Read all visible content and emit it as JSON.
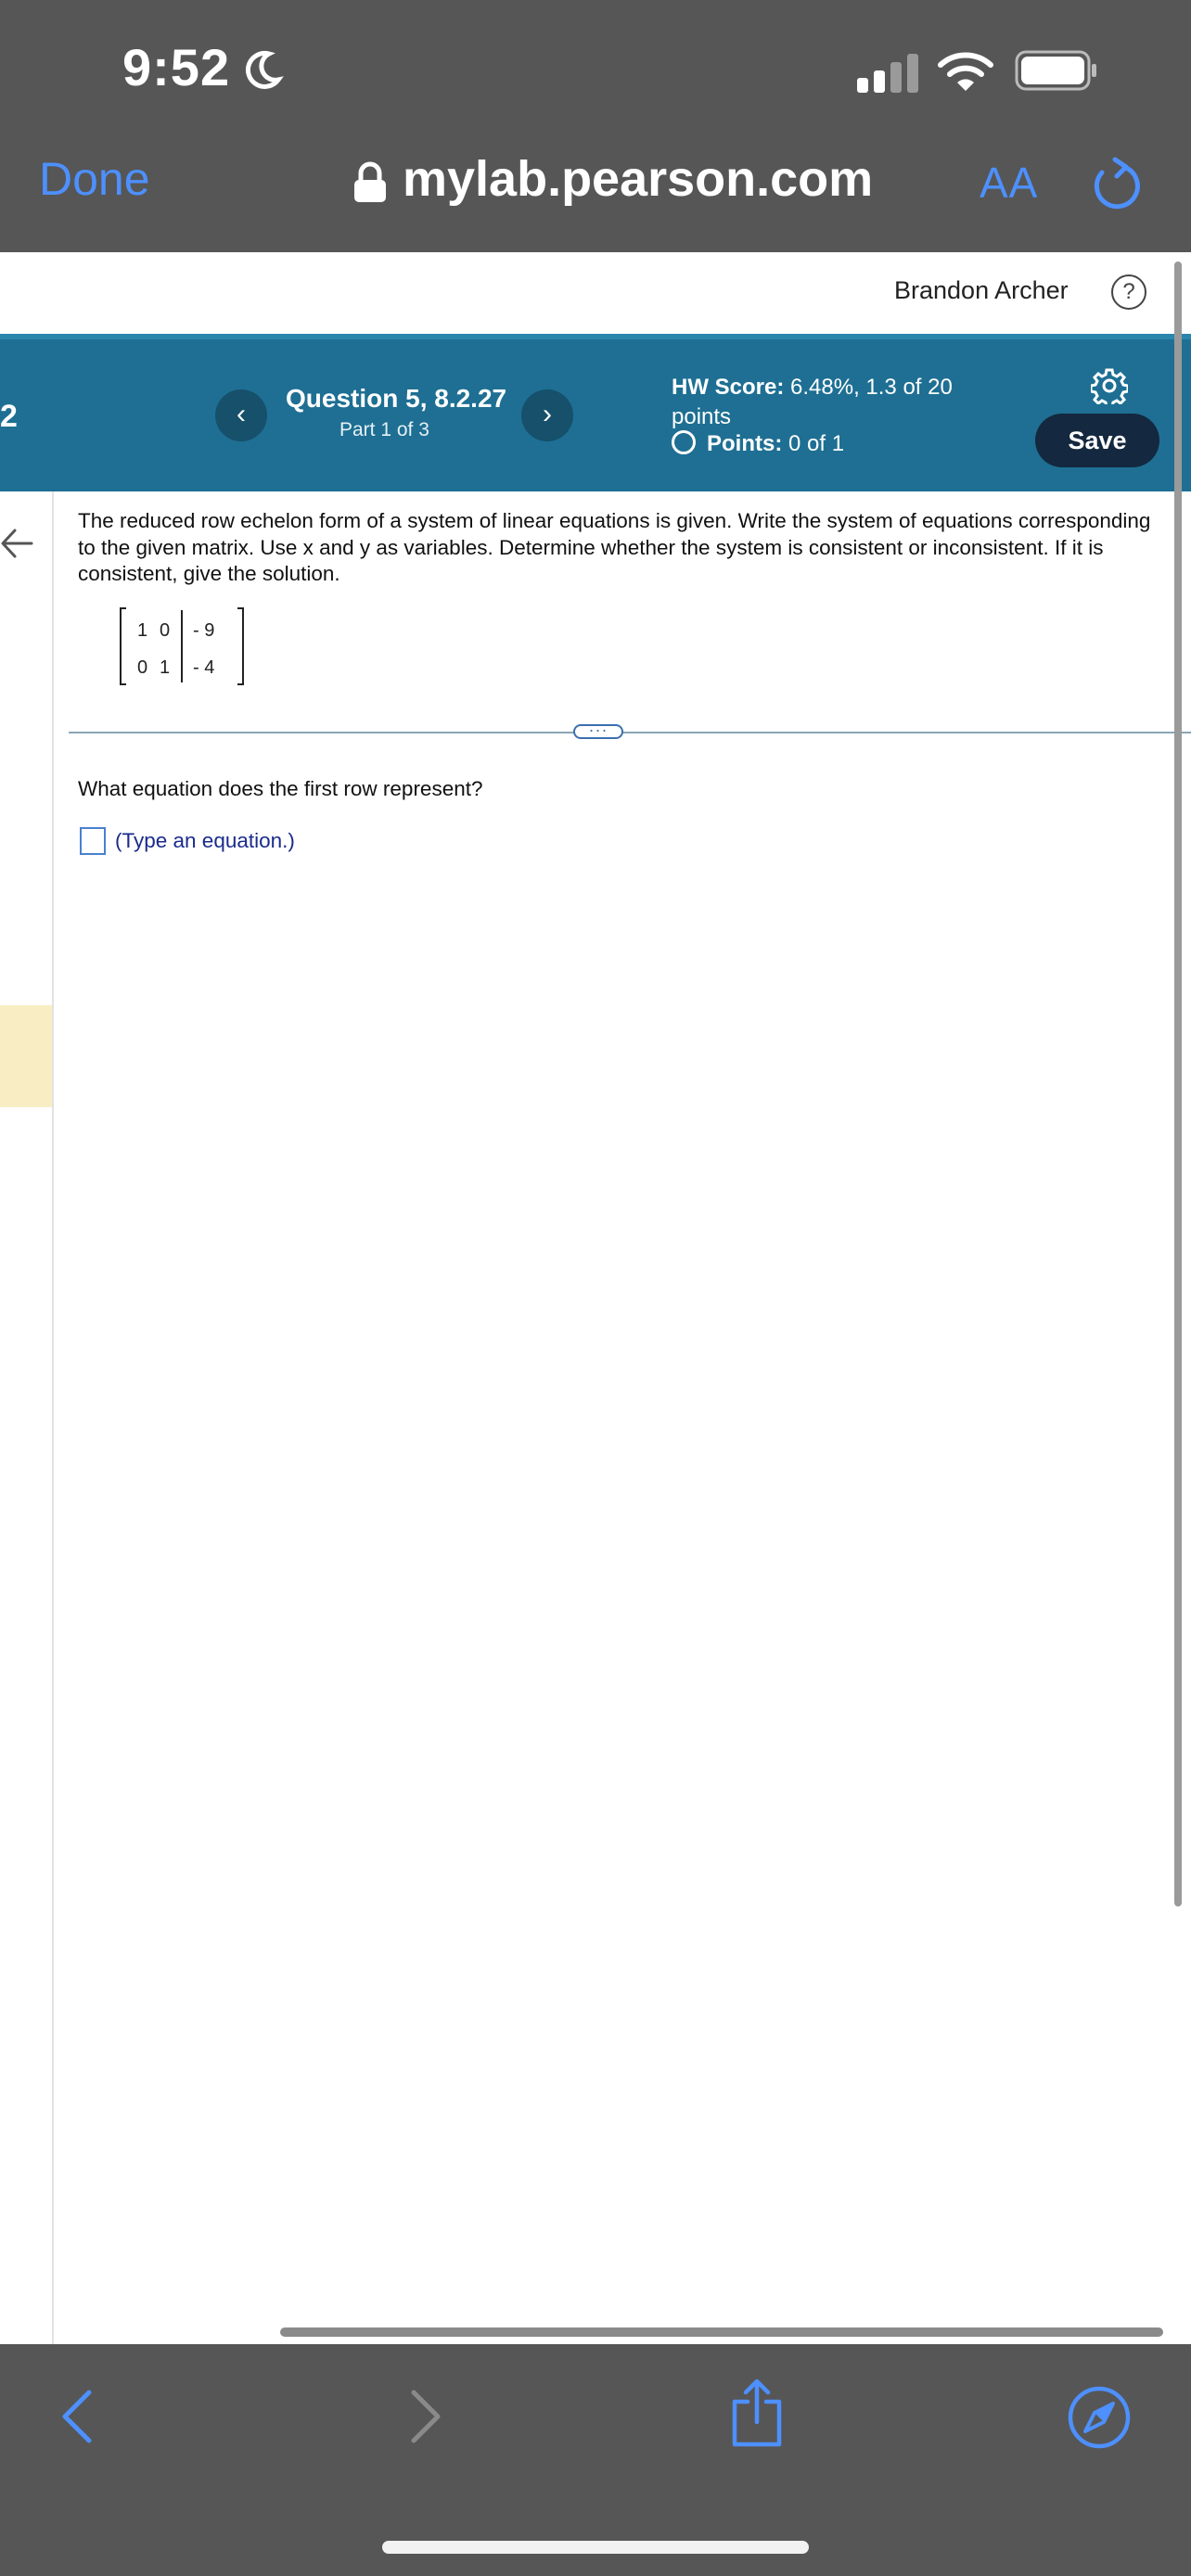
{
  "status_bar": {
    "time": "9:52"
  },
  "browser": {
    "done_label": "Done",
    "url": "mylab.pearson.com",
    "text_size_label": "AA"
  },
  "header": {
    "user_name": "Brandon Archer",
    "help_symbol": "?"
  },
  "question_bar": {
    "left_edge_number": "2",
    "prev_symbol": "‹",
    "next_symbol": "›",
    "title": "Question 5, 8.2.27",
    "part": "Part 1 of 3",
    "hw_score_label": "HW Score:",
    "hw_score_value": " 6.48%, 1.3 of 20 points",
    "points_label": "Points:",
    "points_value": " 0 of 1",
    "save_label": "Save"
  },
  "content": {
    "prompt": "The reduced row echelon form of a system of linear equations is given. Write the system of equations corresponding to the given matrix. Use x and y as variables. Determine whether the system is consistent or inconsistent. If it is consistent, give the solution.",
    "matrix": {
      "row1": [
        "1",
        "0",
        "- 9"
      ],
      "row2": [
        "0",
        "1",
        "- 4"
      ]
    },
    "question": "What equation does the first row represent?",
    "answer_hint": "(Type an equation.)"
  },
  "colors": {
    "chrome": "#565656",
    "accent_blue": "#4d90fe",
    "question_bar": "#1e6f93",
    "save_button": "#14283f"
  },
  "icons": [
    "moon-icon",
    "signal-icon",
    "wifi-icon",
    "battery-icon",
    "lock-icon",
    "reload-icon",
    "help-icon",
    "gear-icon",
    "back-arrow-icon",
    "nav-back-icon",
    "nav-forward-icon",
    "share-icon",
    "compass-icon"
  ]
}
